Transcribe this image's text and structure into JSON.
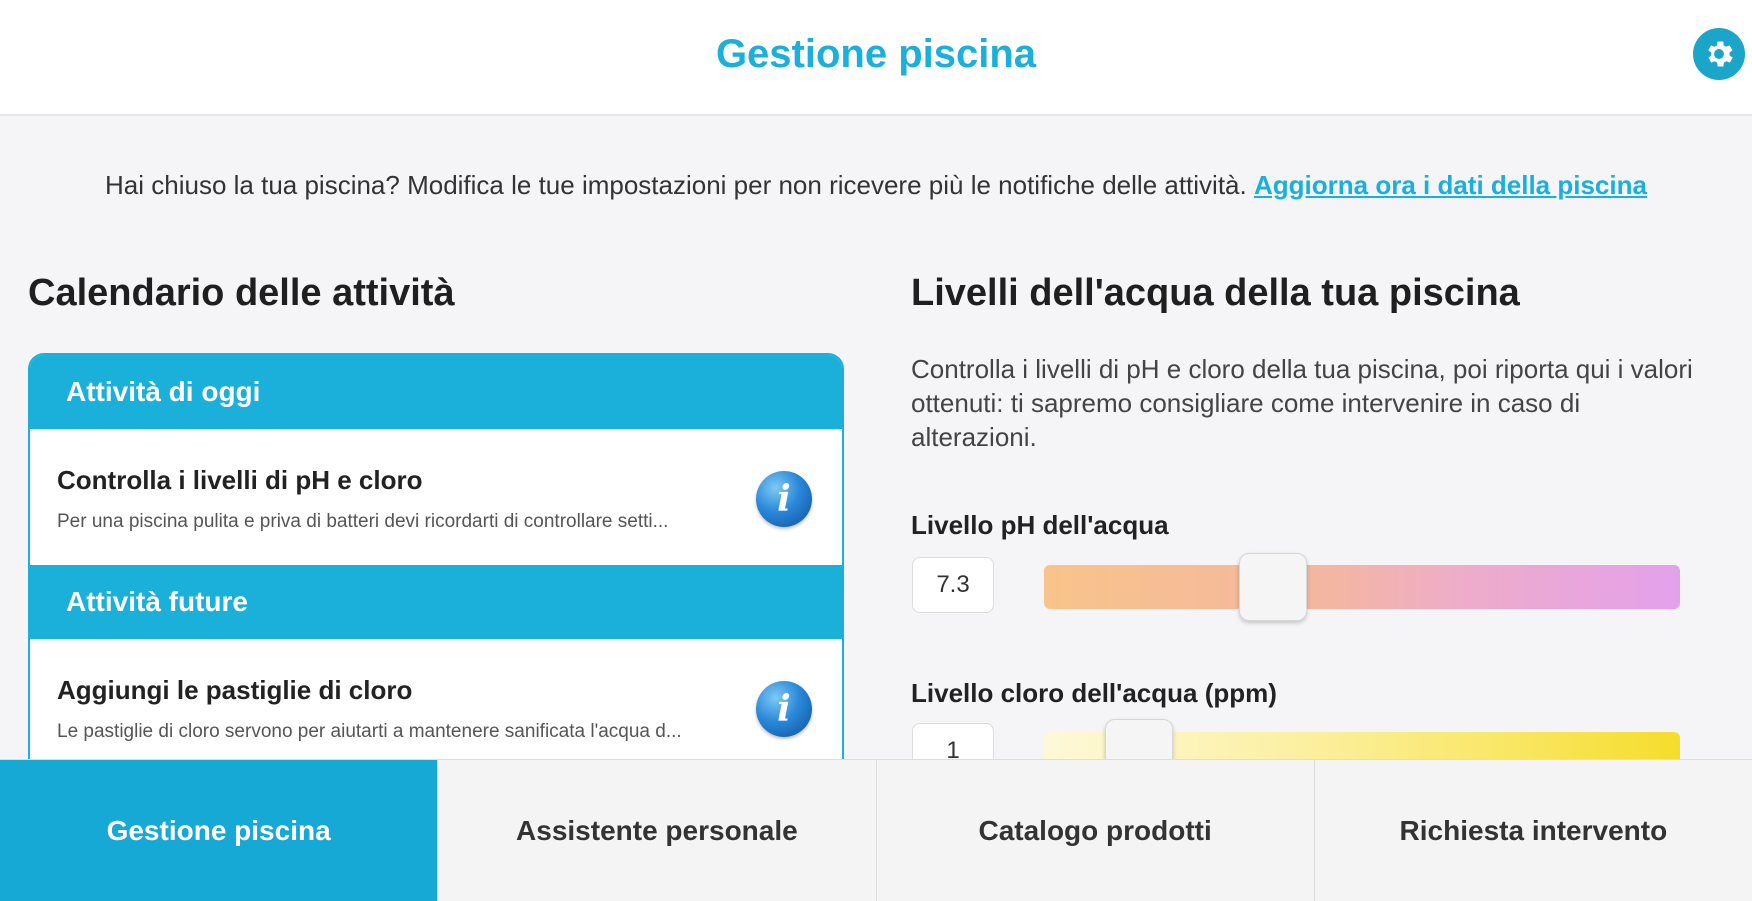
{
  "header": {
    "title": "Gestione piscina",
    "settings_icon": "gear-icon"
  },
  "notice": {
    "text": "Hai chiuso la tua piscina? Modifica le tue impostazioni per non ricevere più le notifiche delle attività.",
    "link": "Aggiorna ora i dati della piscina"
  },
  "calendar": {
    "heading": "Calendario delle attività",
    "today": {
      "label": "Attività di oggi",
      "task": {
        "title": "Controlla i livelli di pH e cloro",
        "desc": "Per una piscina pulita e priva di batteri devi ricordarti di controllare setti..."
      }
    },
    "future": {
      "label": "Attività future",
      "task": {
        "title": "Aggiungi le pastiglie di cloro",
        "desc": "Le pastiglie di cloro servono per aiutarti a mantenere sanificata l'acqua d..."
      }
    },
    "info_glyph": "i"
  },
  "levels": {
    "heading": "Livelli dell'acqua della tua piscina",
    "description": "Controlla i livelli di pH e cloro della tua piscina, poi riporta qui i valori ottenuti: ti sapremo consigliare come intervenire in caso di alterazioni.",
    "ph": {
      "label": "Livello pH dell'acqua",
      "value": "7.3",
      "slider_fraction": 0.36
    },
    "chlorine": {
      "label": "Livello cloro dell'acqua (ppm)",
      "value": "1",
      "slider_fraction": 0.15
    }
  },
  "tabs": [
    {
      "label": "Gestione piscina",
      "active": true
    },
    {
      "label": "Assistente personale",
      "active": false
    },
    {
      "label": "Catalogo prodotti",
      "active": false
    },
    {
      "label": "Richiesta intervento",
      "active": false
    }
  ],
  "colors": {
    "accent": "#1ab0da"
  }
}
